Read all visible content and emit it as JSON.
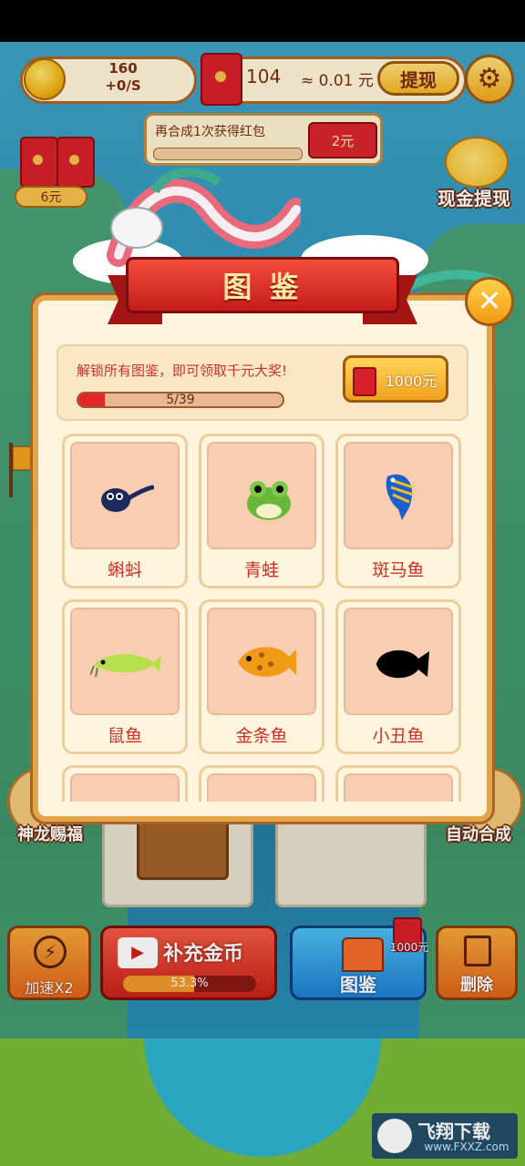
{
  "hud": {
    "coins": "160",
    "coin_rate": "+0/S",
    "red_packets": "104",
    "cash_approx": "≈ 0.01 元",
    "withdraw_label": "提现",
    "settings_icon": "gear-icon"
  },
  "task": {
    "text": "再合成1次获得红包",
    "progress": 0.0,
    "reward": "2元"
  },
  "side": {
    "left_envelope_label": "6元",
    "right_piggy_label": "现金提现",
    "left_orb_label": "神龙赐福",
    "right_orb_label": "自动合成"
  },
  "album": {
    "title": "图 鉴",
    "unlock_text": "解锁所有图鉴，即可领取千元大奖!",
    "progress_text": "5/39",
    "unlocked": 5,
    "total": 39,
    "reward_label": "1000元",
    "cards": [
      {
        "name": "蝌蚪",
        "icon": "tadpole-icon"
      },
      {
        "name": "青蛙",
        "icon": "frog-icon"
      },
      {
        "name": "斑马鱼",
        "icon": "zebrafish-icon"
      },
      {
        "name": "鼠鱼",
        "icon": "catfish-icon"
      },
      {
        "name": "金条鱼",
        "icon": "goldfish-icon"
      },
      {
        "name": "小丑鱼",
        "icon": "clownfish-silhouette-icon"
      }
    ]
  },
  "bottom": {
    "speed_label": "加速X2",
    "coins_label": "补充金币",
    "coins_progress": "53.3%",
    "coins_progress_value": 53.3,
    "album_label": "图鉴",
    "album_badge": "1000元",
    "delete_label": "删除"
  },
  "watermark": {
    "title": "飞翔下载",
    "url": "www.FXXZ.com"
  },
  "colors": {
    "accent_red": "#d8202a",
    "gold": "#f7b521",
    "panel": "#fff4dd",
    "text_red": "#c7332a"
  }
}
